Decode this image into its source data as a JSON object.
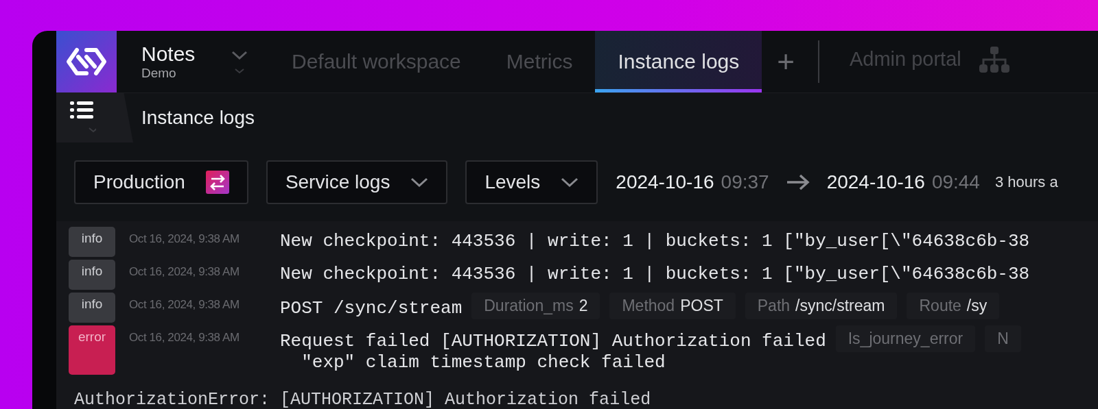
{
  "workspace": {
    "name": "Notes",
    "environment": "Demo"
  },
  "tabs": [
    {
      "label": "Default workspace",
      "selected": false
    },
    {
      "label": "Metrics",
      "selected": false
    },
    {
      "label": "Instance logs",
      "selected": true
    }
  ],
  "add_tab": "+",
  "admin_portal": {
    "label": "Admin portal"
  },
  "page_title": "Instance logs",
  "filters": [
    {
      "label": "Production",
      "kind": "environment"
    },
    {
      "label": "Service logs",
      "kind": "dropdown"
    },
    {
      "label": "Levels",
      "kind": "dropdown"
    }
  ],
  "time_range": {
    "start_date": "2024-10-16",
    "start_time": "09:37",
    "end_date": "2024-10-16",
    "end_time": "09:44",
    "relative": "3 hours a"
  },
  "logs": [
    {
      "level": "info",
      "time": "Oct 16, 2024, 9:38 AM",
      "message": [
        "New checkpoint: 443536 | write: 1 | buckets: 1 [\"by_user[\\\"64638c6b-38"
      ]
    },
    {
      "level": "info",
      "time": "Oct 16, 2024, 9:38 AM",
      "message": [
        "New checkpoint: 443536 | write: 1 | buckets: 1 [\"by_user[\\\"64638c6b-38"
      ]
    },
    {
      "level": "info",
      "time": "Oct 16, 2024, 9:38 AM",
      "message": [
        "POST /sync/stream"
      ],
      "tags": [
        {
          "key": "Duration_ms",
          "value": "2"
        },
        {
          "key": "Method",
          "value": "POST"
        },
        {
          "key": "Path",
          "value": "/sync/stream"
        },
        {
          "key": "Route",
          "value": "/sy"
        }
      ]
    },
    {
      "level": "error",
      "time": "Oct 16, 2024, 9:38 AM",
      "message": [
        "Request failed [AUTHORIZATION] Authorization failed",
        "  \"exp\" claim timestamp check failed"
      ],
      "tags": [
        {
          "key": "Is_journey_error"
        },
        {
          "key": "N"
        }
      ]
    }
  ],
  "stack_trace": "AuthorizationError: [AUTHORIZATION] Authorization failed"
}
